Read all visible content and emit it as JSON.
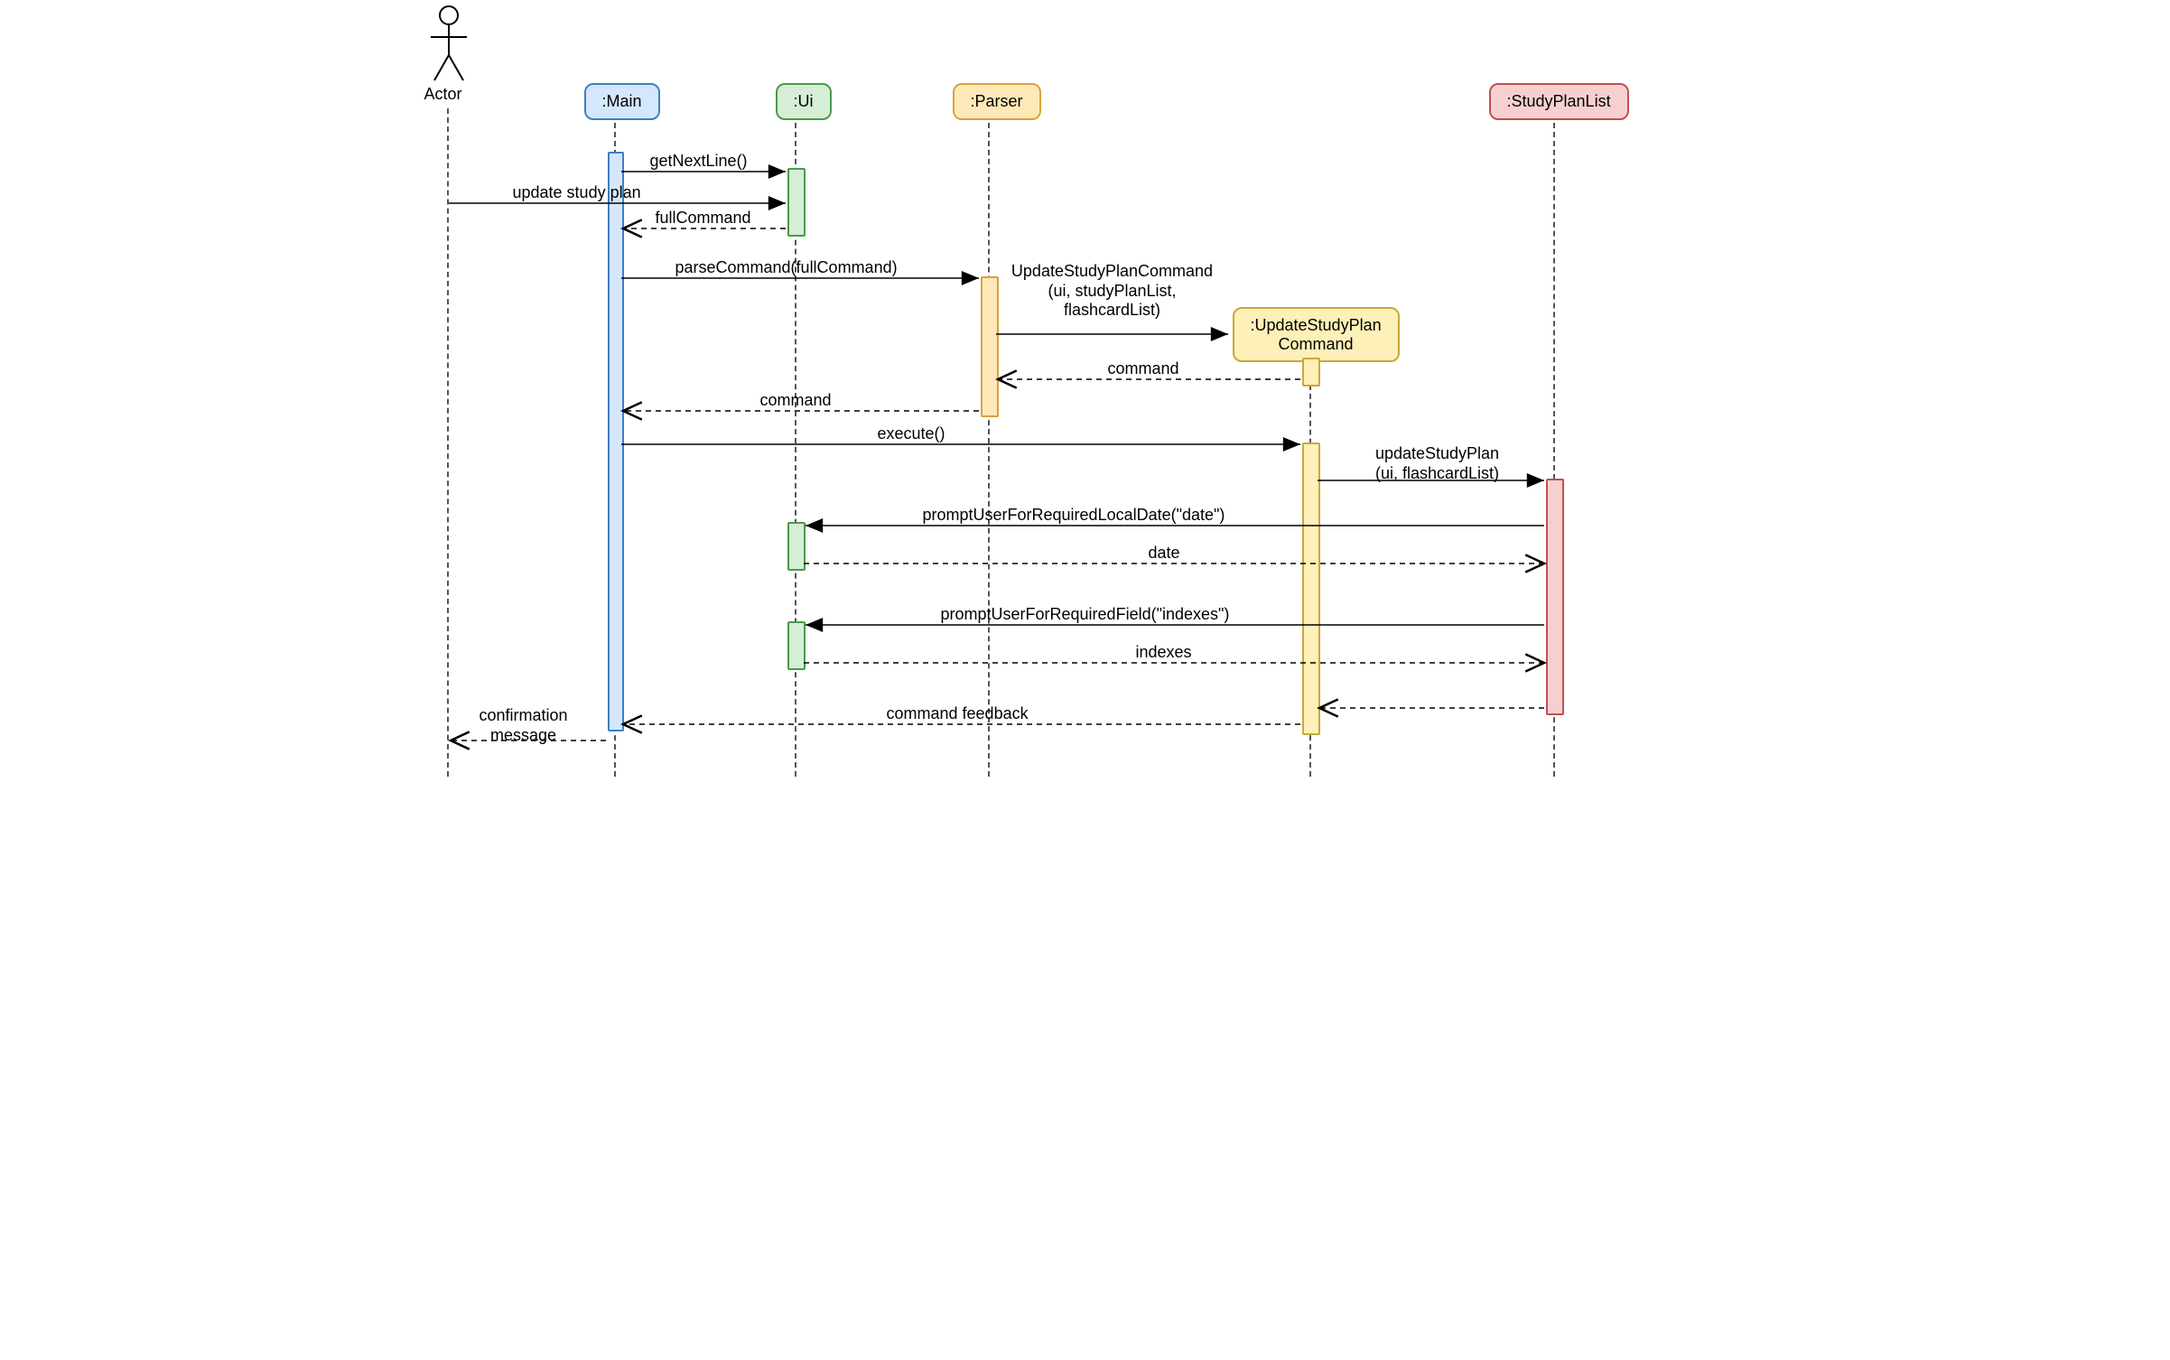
{
  "actor_label": "Actor",
  "participants": {
    "main": ":Main",
    "ui": ":Ui",
    "parser": ":Parser",
    "cmd_line1": ":UpdateStudyPlan",
    "cmd_line2": "Command",
    "spl": ":StudyPlanList"
  },
  "messages": {
    "getNextLine": "getNextLine()",
    "updateStudyPlan": "update study plan",
    "fullCommand": "fullCommand",
    "parseCommand": "parseCommand(fullCommand)",
    "newCmd_l1": "UpdateStudyPlanCommand",
    "newCmd_l2": "(ui, studyPlanList,",
    "newCmd_l3": "flashcardList)",
    "retCommand1": "command",
    "retCommand2": "command",
    "execute": "execute()",
    "updateSP_l1": "updateStudyPlan",
    "updateSP_l2": "(ui, flashcardList)",
    "promptDate": "promptUserForRequiredLocalDate(\"date\")",
    "retDate": "date",
    "promptIndexes": "promptUserForRequiredField(\"indexes\")",
    "retIndexes": "indexes",
    "cmdFeedback": "command feedback",
    "confirm_l1": "confirmation",
    "confirm_l2": "message"
  }
}
